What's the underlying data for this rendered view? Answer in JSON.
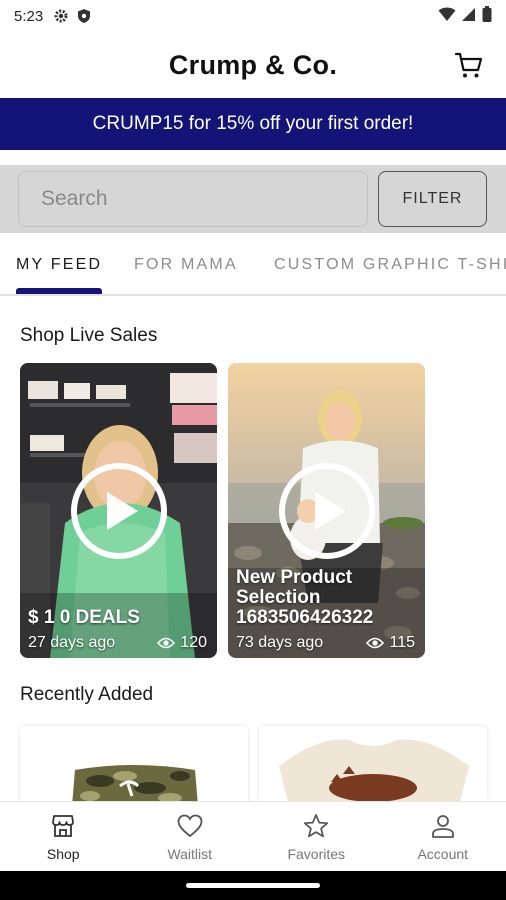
{
  "status_bar": {
    "time": "5:23"
  },
  "app_bar": {
    "title": "Crump & Co."
  },
  "promo": {
    "text": "CRUMP15 for 15% off your first order!"
  },
  "search": {
    "placeholder": "Search",
    "filter_label": "FILTER"
  },
  "tabs": [
    {
      "label": "MY FEED",
      "active": true
    },
    {
      "label": "FOR MAMA",
      "active": false
    },
    {
      "label": "CUSTOM GRAPHIC T-SHI",
      "active": false
    }
  ],
  "live_sales": {
    "title": "Shop Live Sales",
    "cards": [
      {
        "name": "$ 1 0 DEALS",
        "age": "27 days ago",
        "views": "120"
      },
      {
        "name": "New Product\nSelection\n1683506426322",
        "age": "73 days ago",
        "views": "115"
      }
    ]
  },
  "recently_added": {
    "title": "Recently Added"
  },
  "bottom_nav": [
    {
      "label": "Shop",
      "icon": "store-icon",
      "active": true
    },
    {
      "label": "Waitlist",
      "icon": "heart-icon",
      "active": false
    },
    {
      "label": "Favorites",
      "icon": "star-icon",
      "active": false
    },
    {
      "label": "Account",
      "icon": "person-icon",
      "active": false
    }
  ],
  "colors": {
    "brand_navy": "#141478",
    "search_bg": "#d6d6d6"
  }
}
